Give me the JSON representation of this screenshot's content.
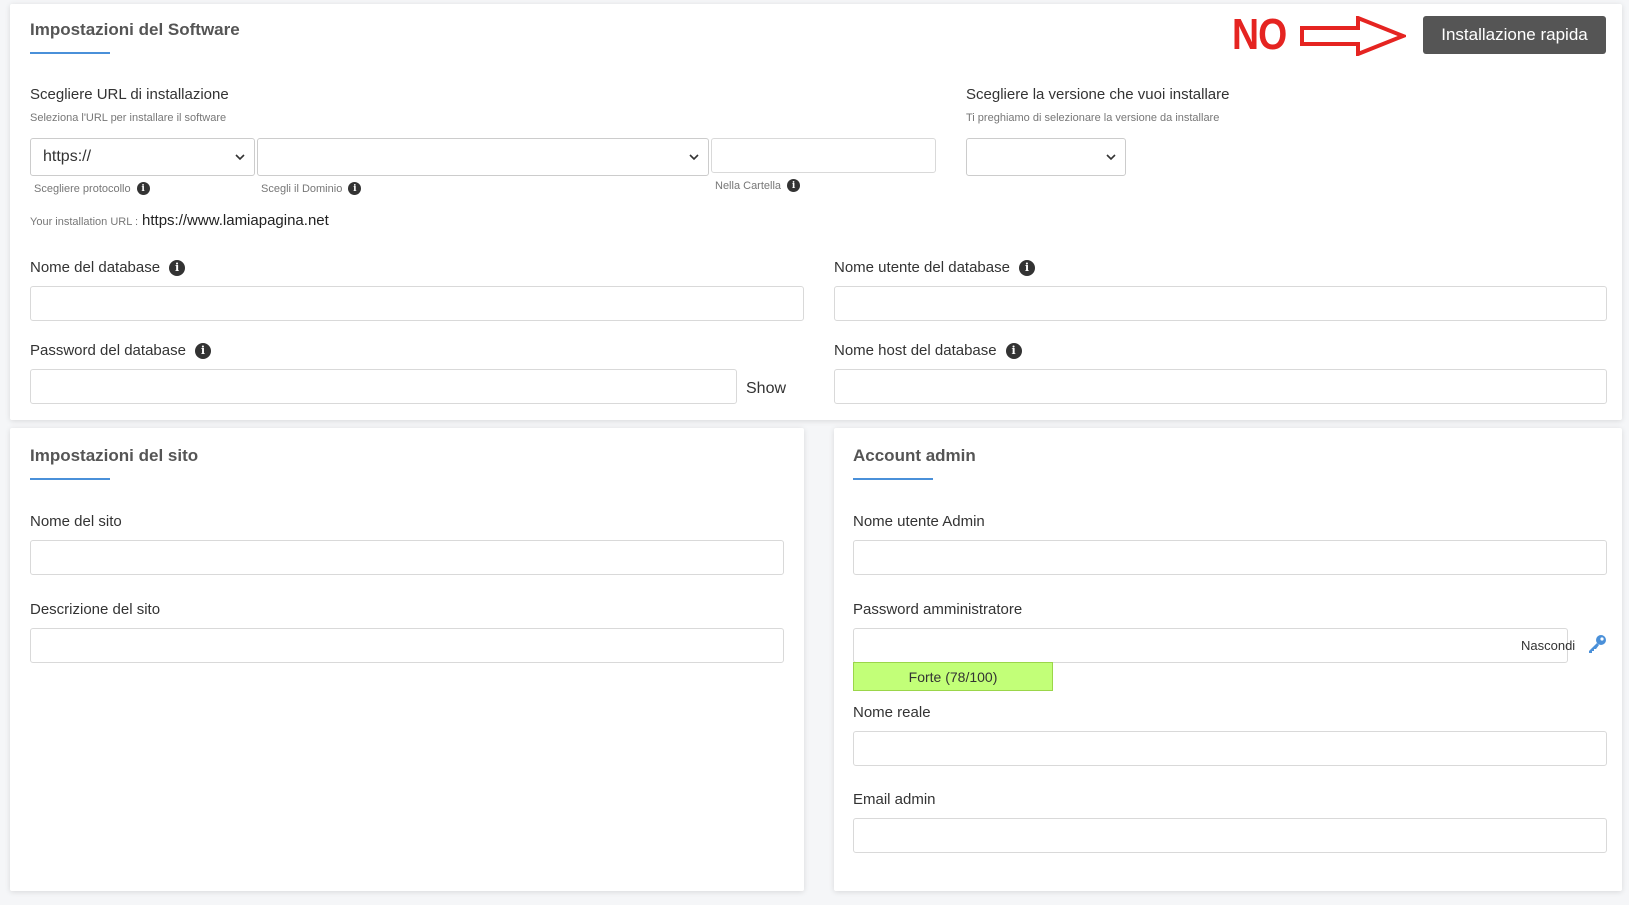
{
  "software": {
    "title": "Impostazioni del Software",
    "quick_install_label": "Installazione rapida",
    "annotation_text": "NO",
    "url_label": "Scegliere URL di installazione",
    "url_hint": "Seleziona l'URL per installare il software",
    "protocol_value": "https://",
    "protocol_hint": "Scegliere protocollo",
    "domain_value": "",
    "domain_hint": "Scegli il Dominio",
    "folder_value": "",
    "folder_hint": "Nella Cartella",
    "install_url_prefix": "Your installation URL :",
    "install_url_value": "https://www.lamiapagina.net",
    "version_label": "Scegliere la versione che vuoi installare",
    "version_hint": "Ti preghiamo di selezionare la versione da installare",
    "version_value": "",
    "db_name_label": "Nome del database",
    "db_name_value": "",
    "db_user_label": "Nome utente del database",
    "db_user_value": "",
    "db_password_label": "Password del database",
    "db_password_value": "",
    "db_password_toggle": "Show",
    "db_host_label": "Nome host del database",
    "db_host_value": ""
  },
  "site": {
    "title": "Impostazioni del sito",
    "name_label": "Nome del sito",
    "name_value": "",
    "description_label": "Descrizione del sito",
    "description_value": ""
  },
  "admin": {
    "title": "Account admin",
    "username_label": "Nome utente Admin",
    "username_value": "",
    "password_label": "Password amministratore",
    "password_value": "",
    "password_toggle": "Nascondi",
    "strength_text": "Forte (78/100)",
    "realname_label": "Nome reale",
    "realname_value": "",
    "email_label": "Email admin",
    "email_value": ""
  },
  "icons": {
    "info": "info-icon",
    "key": "key-icon",
    "chevron": "chevron-down-icon",
    "arrow": "arrow-right-icon"
  },
  "colors": {
    "accent": "#4a90d9",
    "annotation": "#e52421",
    "strength_bg": "#c2ff78",
    "button_bg": "#555555"
  }
}
